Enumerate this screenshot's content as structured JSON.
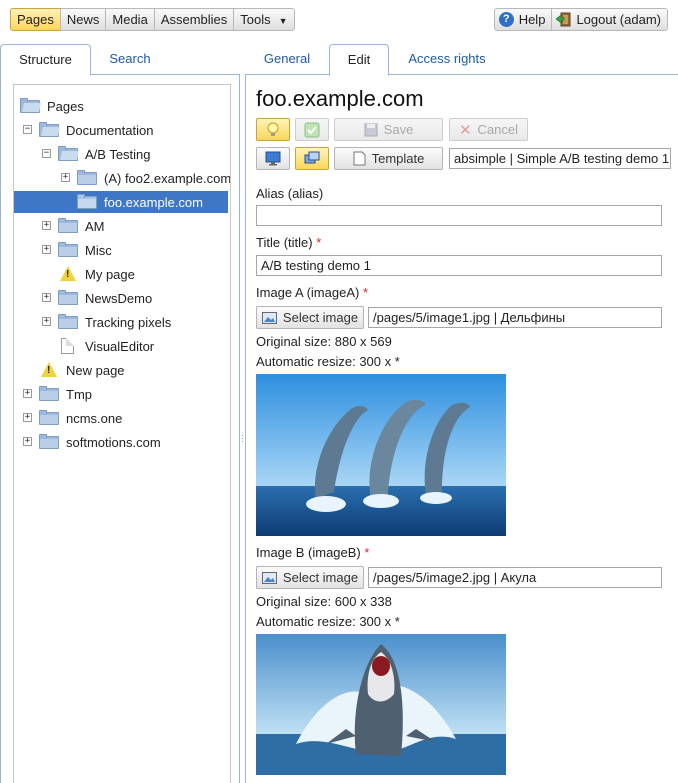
{
  "topnav": {
    "items": [
      "Pages",
      "News",
      "Media",
      "Assemblies",
      "Tools"
    ],
    "help": "Help",
    "logout": "Logout (adam)"
  },
  "left_tabs": [
    "Structure",
    "Search"
  ],
  "tree": {
    "nodes": [
      "Pages",
      "Documentation",
      "A/B Testing",
      "(A) foo2.example.com",
      "foo.example.com",
      "AM",
      "Misc",
      "My page",
      "NewsDemo",
      "Tracking pixels",
      "VisualEditor",
      "New page",
      "Tmp",
      "ncms.one",
      "softmotions.com"
    ],
    "selected": "foo.example.com"
  },
  "right_tabs": [
    "General",
    "Edit",
    "Access rights"
  ],
  "editor": {
    "page_title": "foo.example.com",
    "save_label": "Save",
    "cancel_label": "Cancel",
    "template_label": "Template",
    "template_value": "absimple | Simple A/B testing demo 1",
    "alias_label": "Alias (alias)",
    "alias_value": "",
    "title_label": "Title (title)",
    "title_value": "A/B testing demo 1",
    "required_mark": "*",
    "image_a": {
      "label": "Image A (imageA)",
      "select_label": "Select image",
      "path": "/pages/5/image1.jpg  |  Дельфины",
      "original_size": "Original size: 880 x 569",
      "auto_resize": "Automatic resize: 300 x *"
    },
    "image_b": {
      "label": "Image B (imageB)",
      "select_label": "Select image",
      "path": "/pages/5/image2.jpg  |  Акула",
      "original_size": "Original size: 600 x 338",
      "auto_resize": "Automatic resize: 300 x *"
    }
  },
  "colors": {
    "selection": "#3f77c7",
    "tab_border": "#9ab6d8",
    "active_nav": "#ffd65a"
  }
}
